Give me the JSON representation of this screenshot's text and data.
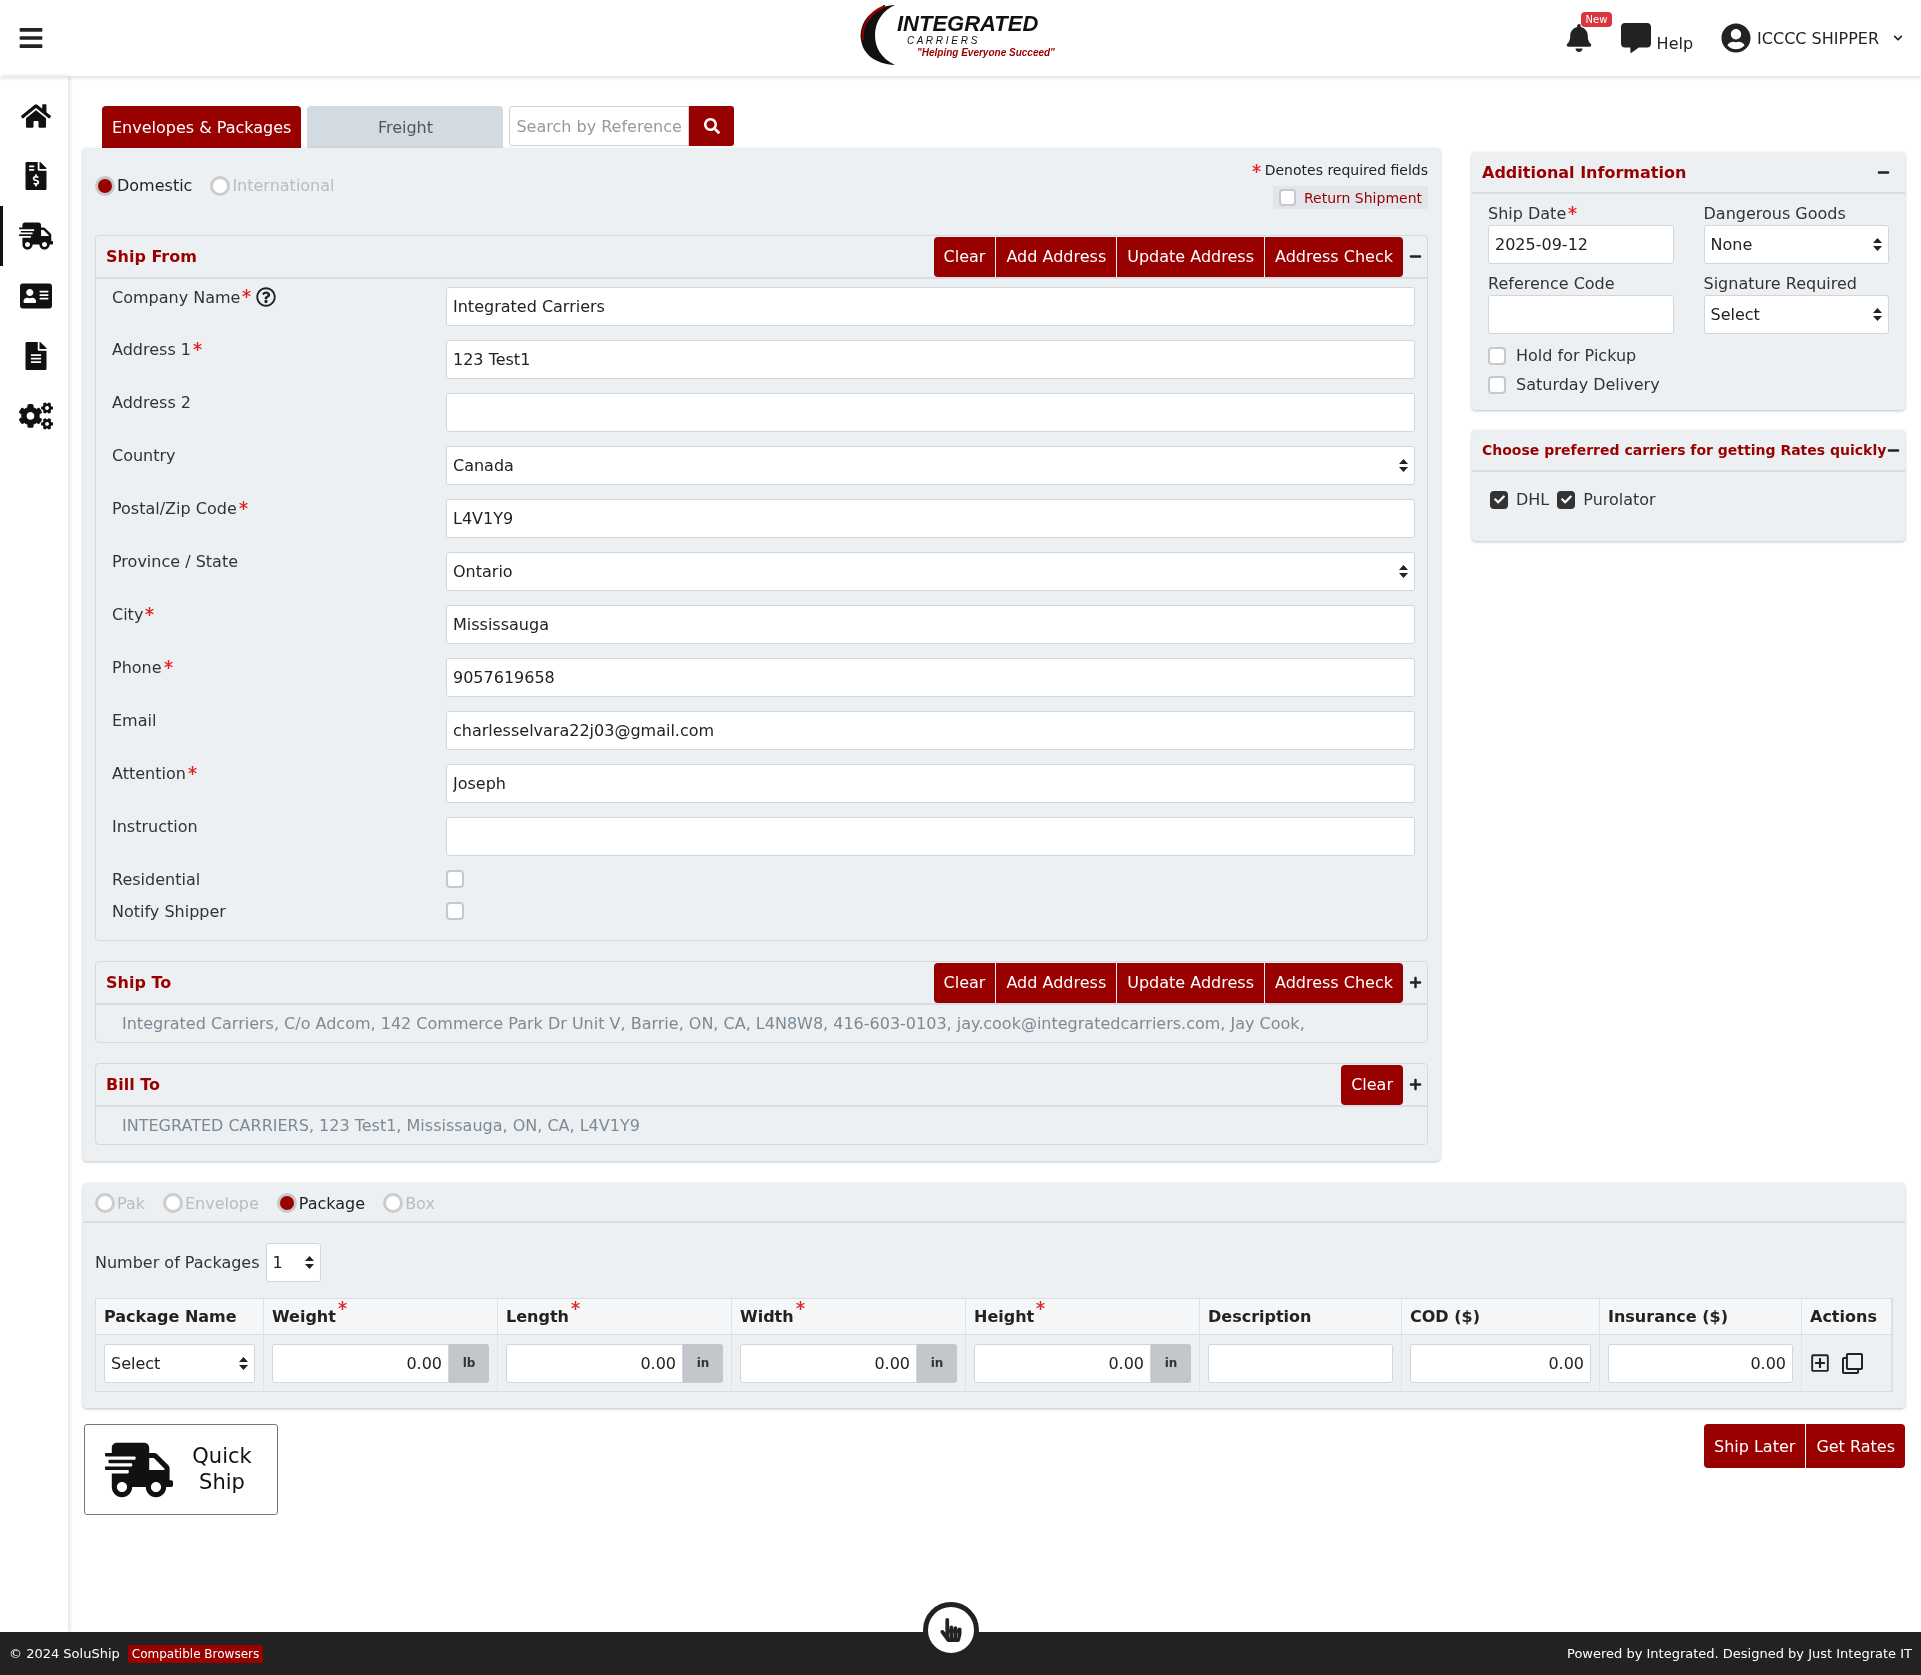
{
  "header": {
    "brand": "INTEGRATED",
    "brand_sub": "C A R R I E R S",
    "tagline": "\"Helping Everyone Succeed\"",
    "notification_badge": "New",
    "help": "Help",
    "user": "ICCCC SHIPPER"
  },
  "sidebar": {
    "items": [
      {
        "kind": "home",
        "selected": false
      },
      {
        "kind": "invoice",
        "selected": false
      },
      {
        "kind": "truck",
        "selected": true
      },
      {
        "kind": "contact",
        "selected": false
      },
      {
        "kind": "document",
        "selected": false
      },
      {
        "kind": "settings",
        "selected": false
      }
    ]
  },
  "tabs": [
    {
      "label": "Envelopes & Packages",
      "selected": true
    },
    {
      "label": "Freight",
      "selected": false
    }
  ],
  "search": {
    "placeholder": "Search by Reference"
  },
  "shipment_types": [
    {
      "label": "Domestic",
      "selected": true,
      "disabled": false
    },
    {
      "label": "International",
      "selected": false,
      "disabled": true
    }
  ],
  "required_note": "Denotes required fields",
  "return_shipment": {
    "label": "Return Shipment",
    "checked": false
  },
  "ship_from": {
    "title": "Ship From",
    "expanded": true,
    "buttons": [
      "Clear",
      "Add Address",
      "Update Address",
      "Address Check"
    ],
    "fields": [
      {
        "kind": "text",
        "label": "Company Name",
        "required": true,
        "help": true,
        "value": "Integrated Carriers"
      },
      {
        "kind": "text",
        "label": "Address 1",
        "required": true,
        "value": "123 Test1"
      },
      {
        "kind": "text",
        "label": "Address 2",
        "required": false
      },
      {
        "kind": "select",
        "label": "Country",
        "required": false,
        "value": "Canada"
      },
      {
        "kind": "text",
        "label": "Postal/Zip Code",
        "required": true,
        "value": "L4V1Y9"
      },
      {
        "kind": "select",
        "label": "Province / State",
        "required": false,
        "value": "Ontario"
      },
      {
        "kind": "text",
        "label": "City",
        "required": true,
        "value": "Mississauga"
      },
      {
        "kind": "text",
        "label": "Phone",
        "required": true,
        "value": "9057619658"
      },
      {
        "kind": "text",
        "label": "Email",
        "required": false,
        "value": "charlesselvara22j03@gmail.com"
      },
      {
        "kind": "text",
        "label": "Attention",
        "required": true,
        "value": "Joseph"
      },
      {
        "kind": "text",
        "label": "Instruction",
        "required": false
      },
      {
        "kind": "checkbox",
        "label": "Residential",
        "required": false,
        "checked": false
      },
      {
        "kind": "checkbox",
        "label": "Notify Shipper",
        "required": false,
        "checked": false
      }
    ]
  },
  "ship_to": {
    "title": "Ship To",
    "expanded": false,
    "buttons": [
      "Clear",
      "Add Address",
      "Update Address",
      "Address Check"
    ],
    "summary": "Integrated Carriers, C/o Adcom, 142 Commerce Park Dr Unit V, Barrie, ON, CA, L4N8W8, 416-603-0103, jay.cook@integratedcarriers.com, Jay Cook,"
  },
  "bill_to": {
    "title": "Bill To",
    "expanded": false,
    "buttons": [
      "Clear"
    ],
    "summary": "INTEGRATED CARRIERS, 123 Test1, Mississauga, ON, CA, L4V1Y9"
  },
  "additional_information": {
    "title": "Additional Information",
    "expanded": true,
    "fields": [
      {
        "kind": "text",
        "label": "Ship Date",
        "required": true,
        "value": "2025-09-12"
      },
      {
        "kind": "select",
        "label": "Dangerous Goods",
        "required": false,
        "value": "None"
      },
      {
        "kind": "text",
        "label": "Reference Code",
        "required": false
      },
      {
        "kind": "select",
        "label": "Signature Required",
        "required": false,
        "value": "Select"
      }
    ],
    "options": [
      {
        "label": "Hold for Pickup",
        "checked": false
      },
      {
        "label": "Saturday Delivery",
        "checked": false
      }
    ]
  },
  "preferred_carriers": {
    "title": "Choose preferred carriers for getting Rates quickly",
    "expanded": true,
    "carriers": [
      {
        "label": "DHL",
        "checked": true
      },
      {
        "label": "Purolator",
        "checked": true
      }
    ]
  },
  "package_types": [
    {
      "label": "Pak",
      "selected": false,
      "disabled": true
    },
    {
      "label": "Envelope",
      "selected": false,
      "disabled": true
    },
    {
      "label": "Package",
      "selected": true,
      "disabled": false
    },
    {
      "label": "Box",
      "selected": false,
      "disabled": true
    }
  ],
  "number_of_packages": {
    "label": "Number of Packages",
    "value": "1"
  },
  "package_table": {
    "columns": [
      {
        "label": "Package Name",
        "required": false
      },
      {
        "label": "Weight",
        "required": true
      },
      {
        "label": "Length",
        "required": true
      },
      {
        "label": "Width",
        "required": true
      },
      {
        "label": "Height",
        "required": true
      },
      {
        "label": "Description",
        "required": false
      },
      {
        "label": "COD ($)",
        "required": false
      },
      {
        "label": "Insurance ($)",
        "required": false
      },
      {
        "label": "Actions",
        "required": false
      }
    ],
    "rows": [
      {
        "package_name": "Select",
        "weight": {
          "value": "0.00",
          "unit": "lb"
        },
        "length": {
          "value": "0.00",
          "unit": "in"
        },
        "width": {
          "value": "0.00",
          "unit": "in"
        },
        "height": {
          "value": "0.00",
          "unit": "in"
        },
        "cod": "0.00",
        "insurance": "0.00"
      }
    ]
  },
  "quick_ship": "Quick Ship",
  "actions": [
    "Ship Later",
    "Get Rates"
  ],
  "footer": {
    "copyright": "© 2024 SoluShip",
    "badge": "Compatible Browsers",
    "credit": "Powered by Integrated. Designed by Just Integrate IT"
  }
}
